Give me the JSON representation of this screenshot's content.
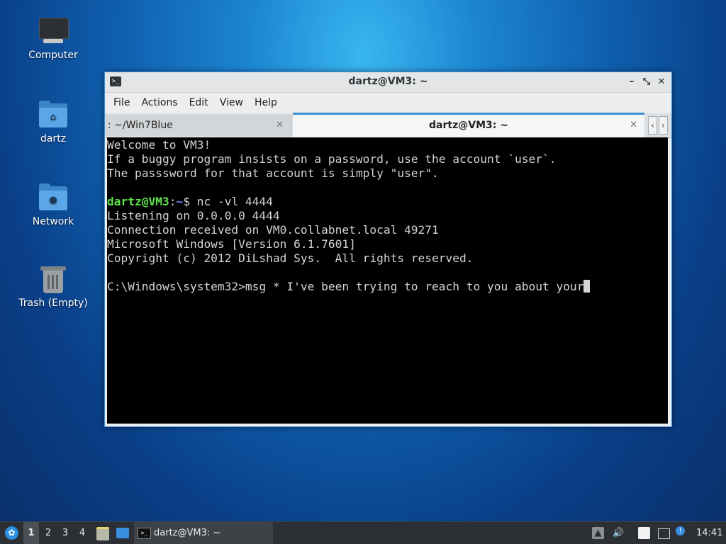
{
  "desktop": {
    "icons": [
      {
        "label": "Computer",
        "icon": "computer-icon"
      },
      {
        "label": "dartz",
        "icon": "home-folder-icon"
      },
      {
        "label": "Network",
        "icon": "network-folder-icon"
      },
      {
        "label": "Trash (Empty)",
        "icon": "trash-icon"
      }
    ]
  },
  "window": {
    "title": "dartz@VM3: ~",
    "controls": {
      "minimize": "–",
      "maximize": "⤡",
      "close": "✕"
    },
    "menu": [
      "File",
      "Actions",
      "Edit",
      "View",
      "Help"
    ],
    "tabs": [
      {
        "label": ": ~/Win7Blue",
        "close": "✕",
        "active": false
      },
      {
        "label": "dartz@VM3: ~",
        "close": "✕",
        "active": true
      }
    ],
    "tab_scroll": {
      "left": "‹",
      "right": "›"
    },
    "terminal": {
      "lines": [
        "Welcome to VM3!",
        "If a buggy program insists on a password, use the account `user`.",
        "The passsword for that account is simply \"user\".",
        "",
        "",
        "Listening on 0.0.0.0 4444",
        "Connection received on VM0.collabnet.local 49271",
        "Microsoft Windows [Version 6.1.7601]",
        "Copyright (c) 2012 DiLshad Sys.  All rights reserved.",
        "",
        "C:\\Windows\\system32>msg * I've been trying to reach to you about your"
      ],
      "prompt": {
        "user": "dartz@VM3",
        "sep": ":",
        "path": "~",
        "symbol": "$",
        "command": " nc -vl 4444"
      }
    }
  },
  "taskbar": {
    "workspaces": [
      "1",
      "2",
      "3",
      "4"
    ],
    "active_workspace": "1",
    "task_label": "dartz@VM3: ~",
    "clock": "14:41"
  },
  "colors": {
    "accent": "#3d8fd6",
    "prompt_user": "#5fe34a",
    "prompt_path": "#6b8ef0",
    "terminal_bg": "#000000",
    "taskbar_bg": "#2c3034"
  }
}
